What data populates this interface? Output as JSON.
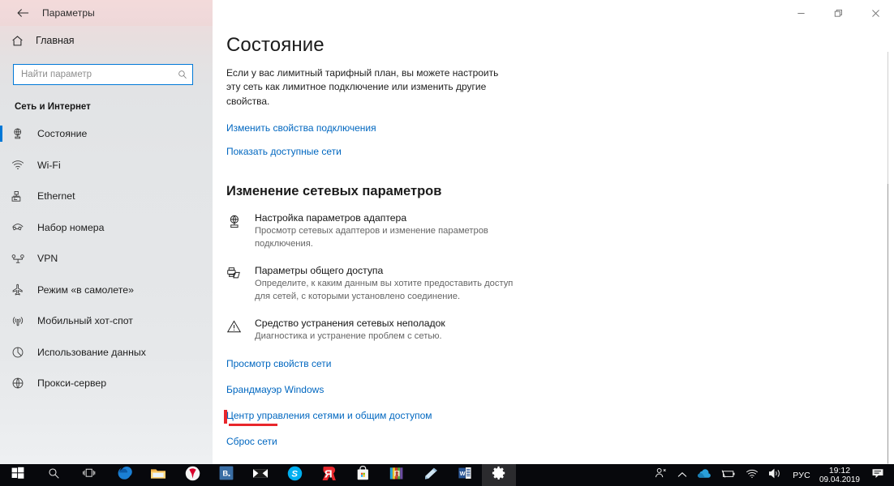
{
  "window": {
    "app_title": "Параметры",
    "back_icon": "back-arrow-icon",
    "minimize_label": "—",
    "restore_label": "❐",
    "close_label": "✕"
  },
  "sidebar": {
    "home": {
      "label": "Главная",
      "icon": "home-icon"
    },
    "search": {
      "placeholder": "Найти параметр",
      "value": "",
      "icon": "search-icon"
    },
    "section_title": "Сеть и Интернет",
    "items": [
      {
        "label": "Состояние",
        "icon": "network-status-icon",
        "selected": true
      },
      {
        "label": "Wi-Fi",
        "icon": "wifi-icon",
        "selected": false
      },
      {
        "label": "Ethernet",
        "icon": "ethernet-icon",
        "selected": false
      },
      {
        "label": "Набор номера",
        "icon": "dialup-icon",
        "selected": false
      },
      {
        "label": "VPN",
        "icon": "vpn-icon",
        "selected": false
      },
      {
        "label": "Режим «в самолете»",
        "icon": "airplane-icon",
        "selected": false
      },
      {
        "label": "Мобильный хот-спот",
        "icon": "hotspot-icon",
        "selected": false
      },
      {
        "label": "Использование данных",
        "icon": "data-usage-icon",
        "selected": false
      },
      {
        "label": "Прокси-сервер",
        "icon": "proxy-globe-icon",
        "selected": false
      }
    ]
  },
  "main": {
    "title": "Состояние",
    "description": "Если у вас лимитный тарифный план, вы можете настроить эту сеть как лимитное подключение или изменить другие свойства.",
    "top_links": [
      {
        "label": "Изменить свойства подключения"
      },
      {
        "label": "Показать доступные сети"
      }
    ],
    "section_title": "Изменение сетевых параметров",
    "settings": [
      {
        "icon": "adapter-settings-icon",
        "title": "Настройка параметров адаптера",
        "desc": "Просмотр сетевых адаптеров и изменение параметров подключения."
      },
      {
        "icon": "sharing-options-icon",
        "title": "Параметры общего доступа",
        "desc": "Определите, к каким данным вы хотите предоставить доступ для сетей, с которыми установлено соединение."
      },
      {
        "icon": "troubleshooter-warning-icon",
        "title": "Средство устранения сетевых неполадок",
        "desc": "Диагностика и устранение проблем с сетью."
      }
    ],
    "bottom_links": [
      {
        "label": "Просмотр свойств сети",
        "annotated": false
      },
      {
        "label": "Брандмауэр Windows",
        "annotated": false
      },
      {
        "label": "Центр управления сетями и общим доступом",
        "annotated": true
      },
      {
        "label": "Сброс сети",
        "annotated": false
      }
    ]
  },
  "annotation": {
    "color": "#e8272c",
    "target": "Центр управления сетями и общим доступом"
  },
  "taskbar": {
    "pinned": [
      {
        "name": "start-button",
        "icon": "windows-logo-icon"
      },
      {
        "name": "search-button",
        "icon": "search-icon"
      },
      {
        "name": "task-view-button",
        "icon": "task-view-icon"
      },
      {
        "name": "edge-button",
        "icon": "edge-browser-icon"
      },
      {
        "name": "file-explorer-button",
        "icon": "folder-icon"
      },
      {
        "name": "yandex-browser-button",
        "icon": "yandex-browser-icon"
      },
      {
        "name": "vkontakte-button",
        "icon": "vk-icon"
      },
      {
        "name": "mail-button",
        "icon": "mail-envelope-icon"
      },
      {
        "name": "skype-button",
        "icon": "skype-icon"
      },
      {
        "name": "yandex-button",
        "icon": "yandex-logo-icon"
      },
      {
        "name": "microsoft-store-button",
        "icon": "store-bag-icon"
      },
      {
        "name": "winrar-button",
        "icon": "winrar-books-icon"
      },
      {
        "name": "notepad-button",
        "icon": "notepad-icon"
      },
      {
        "name": "word-button",
        "icon": "word-document-icon"
      },
      {
        "name": "settings-button",
        "icon": "gear-icon"
      }
    ],
    "tray": {
      "people_icon": "people-icon",
      "chevron_icon": "show-hidden-icons-chevron",
      "onedrive_icon": "onedrive-cloud-icon",
      "battery_icon": "battery-icon",
      "wifi_icon": "wifi-icon",
      "volume_icon": "speaker-volume-icon",
      "language": "РУС",
      "time": "19:12",
      "date": "09.04.2019",
      "action_center_icon": "action-center-icon"
    }
  }
}
